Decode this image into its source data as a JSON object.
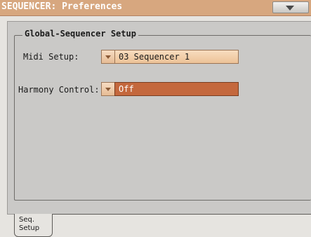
{
  "window": {
    "title": "SEQUENCER: Preferences",
    "menu_icon": "triangle-down-icon"
  },
  "group": {
    "title": "Global-Sequencer Setup"
  },
  "fields": {
    "midi_setup": {
      "label": "Midi Setup:",
      "value": "03 Sequencer 1"
    },
    "harmony_control": {
      "label": "Harmony Control:",
      "value": "Off"
    }
  },
  "tabs": [
    {
      "line1": "Seq.",
      "line2": "Setup",
      "active": true
    }
  ],
  "colors": {
    "titlebar": "#d7a77f",
    "dropdown": "#ecc297",
    "dropdown_selected": "#c4683d",
    "panel": "#cac9c7"
  }
}
